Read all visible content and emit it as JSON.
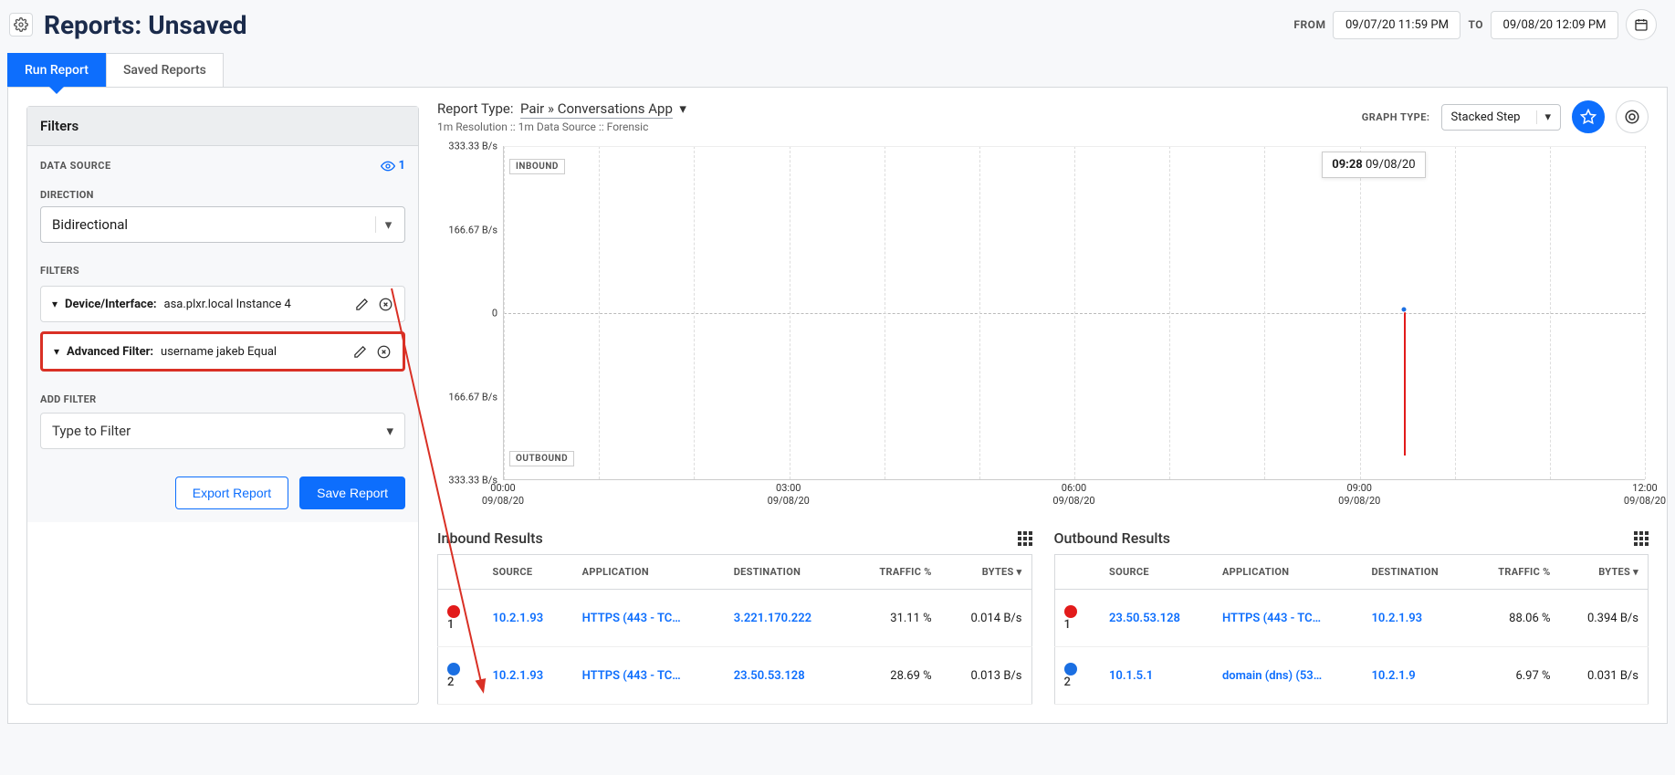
{
  "page_title": "Reports: Unsaved",
  "date_range": {
    "from_label": "FROM",
    "from_value": "09/07/20 11:59 PM",
    "to_label": "TO",
    "to_value": "09/08/20 12:09 PM"
  },
  "tabs": {
    "run": "Run Report",
    "saved": "Saved Reports"
  },
  "filters": {
    "header": "Filters",
    "data_source_label": "DATA SOURCE",
    "data_source_count": "1",
    "direction_label": "DIRECTION",
    "direction_value": "Bidirectional",
    "filters_label": "FILTERS",
    "items": [
      {
        "name": "Device/Interface:",
        "value": "asa.plxr.local Instance 4"
      },
      {
        "name": "Advanced Filter:",
        "value": "username jakeb Equal"
      }
    ],
    "add_filter_label": "ADD FILTER",
    "add_filter_placeholder": "Type to Filter",
    "export_btn": "Export Report",
    "save_btn": "Save Report"
  },
  "report": {
    "type_label": "Report Type:",
    "type_value": "Pair » Conversations App",
    "meta": "1m Resolution :: 1m Data Source :: Forensic",
    "graph_type_label": "GRAPH TYPE:",
    "graph_type_value": "Stacked Step",
    "tooltip_time": "09:28",
    "tooltip_date": "09/08/20"
  },
  "chart_data": {
    "type": "area",
    "title": "",
    "xlabel": "",
    "ylabel": "B/s",
    "y_ticks": [
      "333.33 B/s",
      "166.67 B/s",
      "0",
      "166.67 B/s",
      "333.33 B/s"
    ],
    "x_ticks": [
      {
        "time": "00:00",
        "date": "09/08/20",
        "pct": 0
      },
      {
        "time": "03:00",
        "date": "09/08/20",
        "pct": 25
      },
      {
        "time": "06:00",
        "date": "09/08/20",
        "pct": 50
      },
      {
        "time": "09:00",
        "date": "09/08/20",
        "pct": 75
      },
      {
        "time": "12:00",
        "date": "09/08/20",
        "pct": 100
      }
    ],
    "inbound_tag": "INBOUND",
    "outbound_tag": "OUTBOUND",
    "event": {
      "x_pct": 78.9,
      "inbound_value_bps": 0.03,
      "outbound_value_bps": 0.4,
      "time": "09:28",
      "date": "09/08/20"
    }
  },
  "results": {
    "inbound_title": "Inbound Results",
    "outbound_title": "Outbound Results",
    "columns": {
      "source": "SOURCE",
      "application": "APPLICATION",
      "destination": "DESTINATION",
      "traffic": "TRAFFIC %",
      "bytes": "BYTES"
    },
    "inbound": [
      {
        "color": "#e21b1b",
        "idx": "1",
        "source": "10.2.1.93",
        "application": "HTTPS (443 - TC…",
        "destination": "3.221.170.222",
        "traffic": "31.11 %",
        "bytes": "0.014 B/s"
      },
      {
        "color": "#1b6fe2",
        "idx": "2",
        "source": "10.2.1.93",
        "application": "HTTPS (443 - TC…",
        "destination": "23.50.53.128",
        "traffic": "28.69 %",
        "bytes": "0.013 B/s"
      }
    ],
    "outbound": [
      {
        "color": "#e21b1b",
        "idx": "1",
        "source": "23.50.53.128",
        "application": "HTTPS (443 - TC…",
        "destination": "10.2.1.93",
        "traffic": "88.06 %",
        "bytes": "0.394 B/s"
      },
      {
        "color": "#1b6fe2",
        "idx": "2",
        "source": "10.1.5.1",
        "application": "domain (dns) (53…",
        "destination": "10.2.1.9",
        "traffic": "6.97 %",
        "bytes": "0.031 B/s"
      }
    ]
  }
}
